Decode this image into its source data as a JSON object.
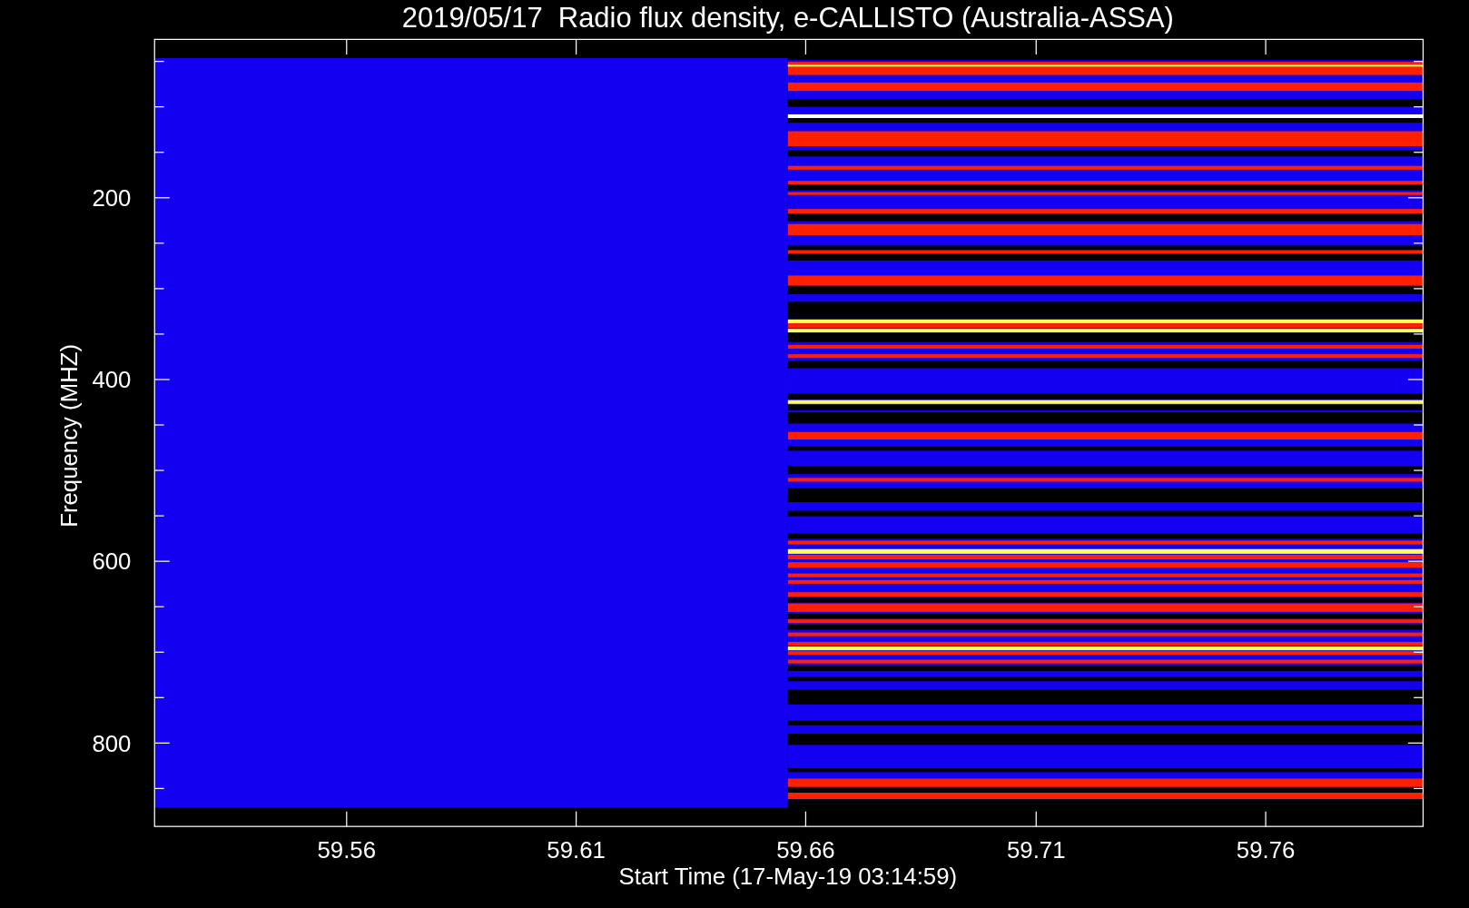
{
  "plot": {
    "title": "2019/05/17  Radio flux density, e-CALLISTO (Australia-ASSA)",
    "xlabel": "Start Time (17-May-19 03:14:59)",
    "ylabel": "Frequency (MHZ)",
    "x_tick_labels": [
      "59.56",
      "59.61",
      "59.66",
      "59.71",
      "59.76"
    ],
    "y_tick_labels": [
      "200",
      "400",
      "600",
      "800"
    ]
  }
}
